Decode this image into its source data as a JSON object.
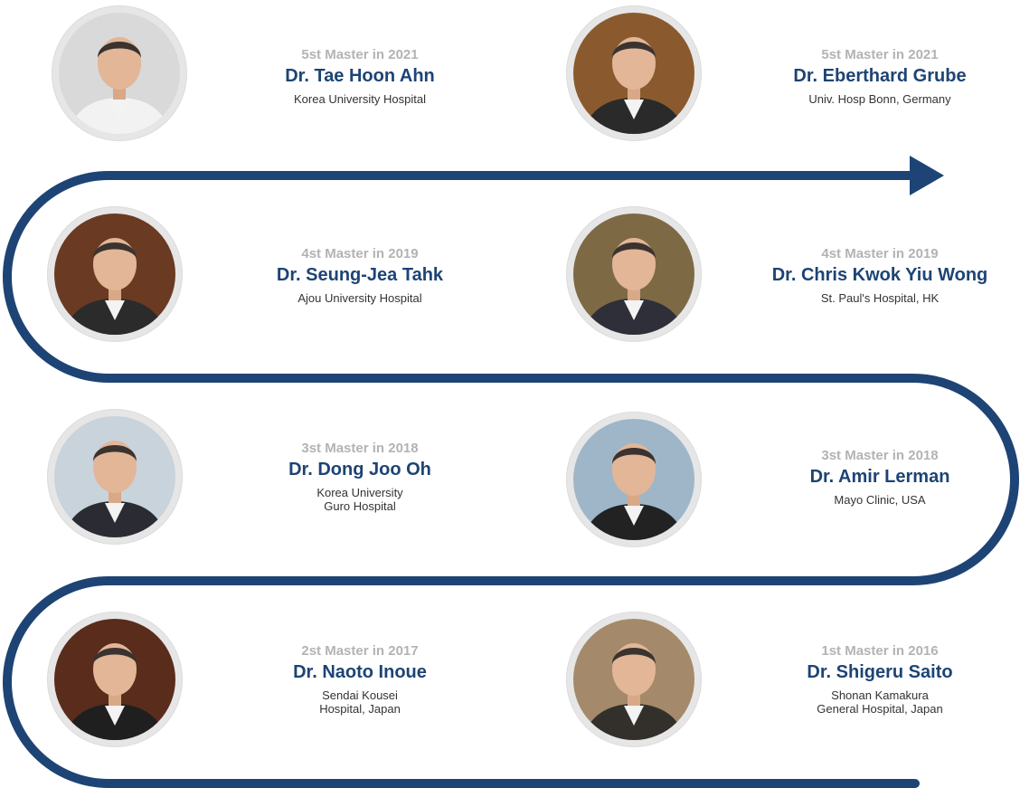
{
  "colors": {
    "accent": "#1d4474",
    "edition": "#b3b3b3",
    "text": "#333333"
  },
  "masters": [
    {
      "edition": "5st Master in 2021",
      "name": "Dr. Tae Hoon Ahn",
      "affiliation": "Korea University Hospital",
      "photo_bg": "#d9d9d9",
      "suit": "#f2f2f2"
    },
    {
      "edition": "5st Master in 2021",
      "name": "Dr. Eberthard Grube",
      "affiliation": "Univ. Hosp Bonn, Germany",
      "photo_bg": "#8a5a2e",
      "suit": "#2a2a2a"
    },
    {
      "edition": "4st Master in 2019",
      "name": "Dr. Seung-Jea Tahk",
      "affiliation": "Ajou University Hospital",
      "photo_bg": "#6b3a22",
      "suit": "#2b2b2b"
    },
    {
      "edition": "4st Master in 2019",
      "name": "Dr. Chris Kwok Yiu Wong",
      "affiliation": "St. Paul's Hospital, HK",
      "photo_bg": "#7d6a45",
      "suit": "#2f2f3a"
    },
    {
      "edition": "3st Master in 2018",
      "name": "Dr. Dong Joo Oh",
      "affiliation": "Korea University\nGuro Hospital",
      "photo_bg": "#c9d3dc",
      "suit": "#2b2b33"
    },
    {
      "edition": "3st Master in 2018",
      "name": "Dr. Amir Lerman",
      "affiliation": "Mayo Clinic, USA",
      "photo_bg": "#9fb6c8",
      "suit": "#222222"
    },
    {
      "edition": "2st Master in 2017",
      "name": "Dr. Naoto Inoue",
      "affiliation": "Sendai Kousei\nHospital, Japan",
      "photo_bg": "#5a2c1c",
      "suit": "#1f1f1f"
    },
    {
      "edition": "1st Master in 2016",
      "name": "Dr. Shigeru Saito",
      "affiliation": "Shonan Kamakura\nGeneral Hospital, Japan",
      "photo_bg": "#a48a6a",
      "suit": "#33302c"
    }
  ]
}
